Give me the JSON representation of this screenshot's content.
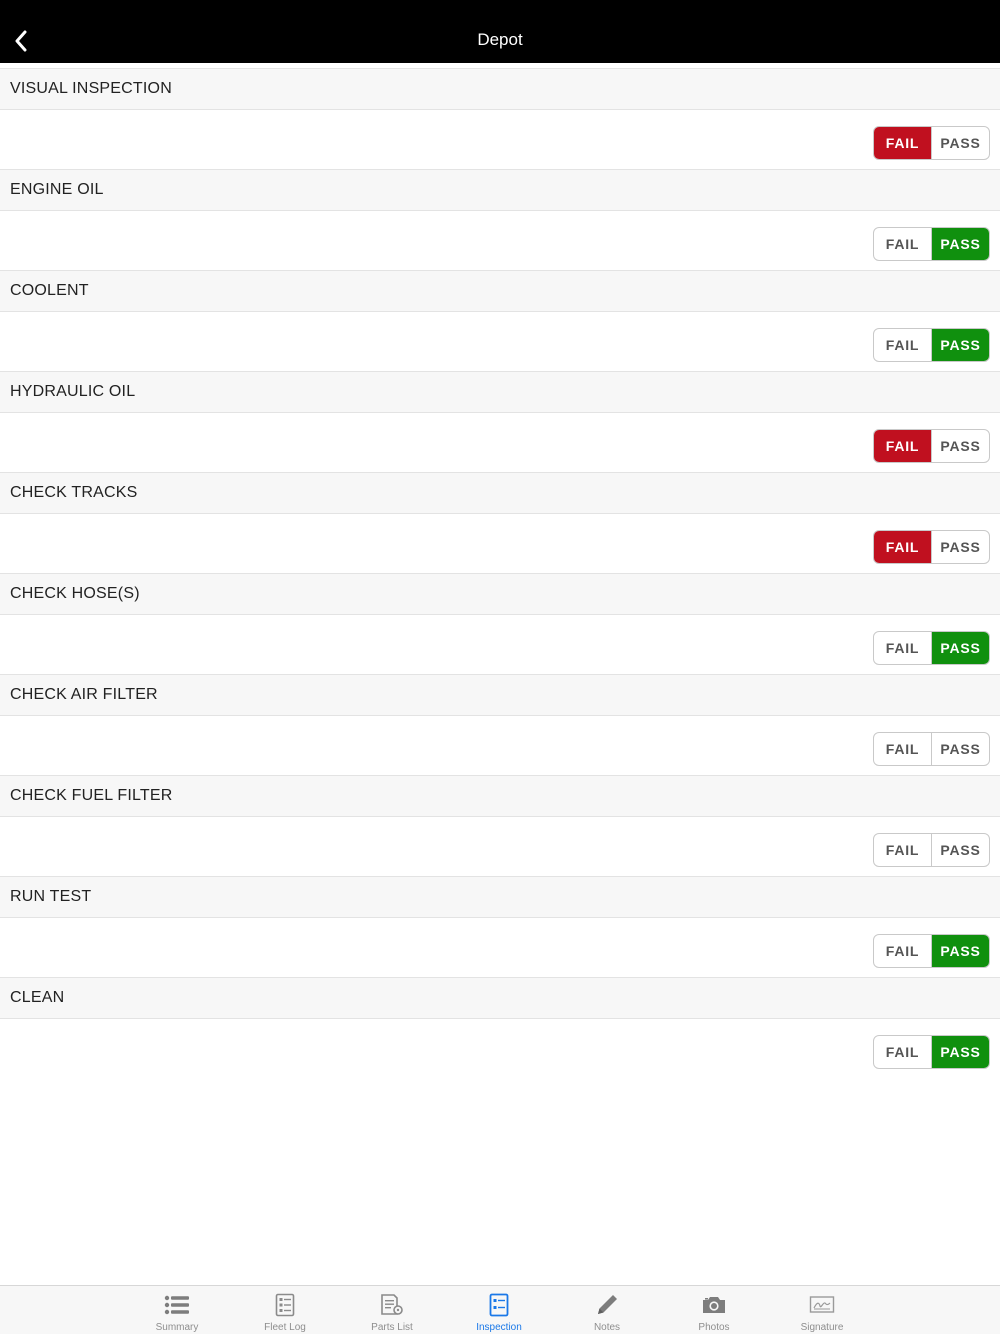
{
  "navbar": {
    "title": "Depot",
    "back_icon": "chevron-left-icon"
  },
  "colors": {
    "fail_active": "#c0101f",
    "pass_active": "#10900e",
    "tab_active": "#1a78e8",
    "tab_inactive": "#8e8e8e"
  },
  "options": {
    "fail_label": "FAIL",
    "pass_label": "PASS"
  },
  "inspection_items": [
    {
      "label": "VISUAL INSPECTION",
      "selected": "fail"
    },
    {
      "label": "ENGINE OIL",
      "selected": "pass"
    },
    {
      "label": "COOLENT",
      "selected": "pass"
    },
    {
      "label": "HYDRAULIC OIL",
      "selected": "fail"
    },
    {
      "label": "CHECK TRACKS",
      "selected": "fail"
    },
    {
      "label": "CHECK HOSE(S)",
      "selected": "pass"
    },
    {
      "label": "CHECK AIR FILTER",
      "selected": "none"
    },
    {
      "label": "CHECK FUEL FILTER",
      "selected": "none"
    },
    {
      "label": "RUN TEST",
      "selected": "pass"
    },
    {
      "label": "CLEAN",
      "selected": "pass"
    }
  ],
  "tabbar": {
    "active": "inspection",
    "tabs": [
      {
        "id": "summary",
        "label": "Summary",
        "icon": "list-icon"
      },
      {
        "id": "fleet-log",
        "label": "Fleet Log",
        "icon": "log-document-icon"
      },
      {
        "id": "parts-list",
        "label": "Parts List",
        "icon": "parts-list-icon"
      },
      {
        "id": "inspection",
        "label": "Inspection",
        "icon": "inspection-checklist-icon"
      },
      {
        "id": "notes",
        "label": "Notes",
        "icon": "pencil-icon"
      },
      {
        "id": "photos",
        "label": "Photos",
        "icon": "camera-icon"
      },
      {
        "id": "signature",
        "label": "Signature",
        "icon": "signature-icon"
      }
    ]
  }
}
